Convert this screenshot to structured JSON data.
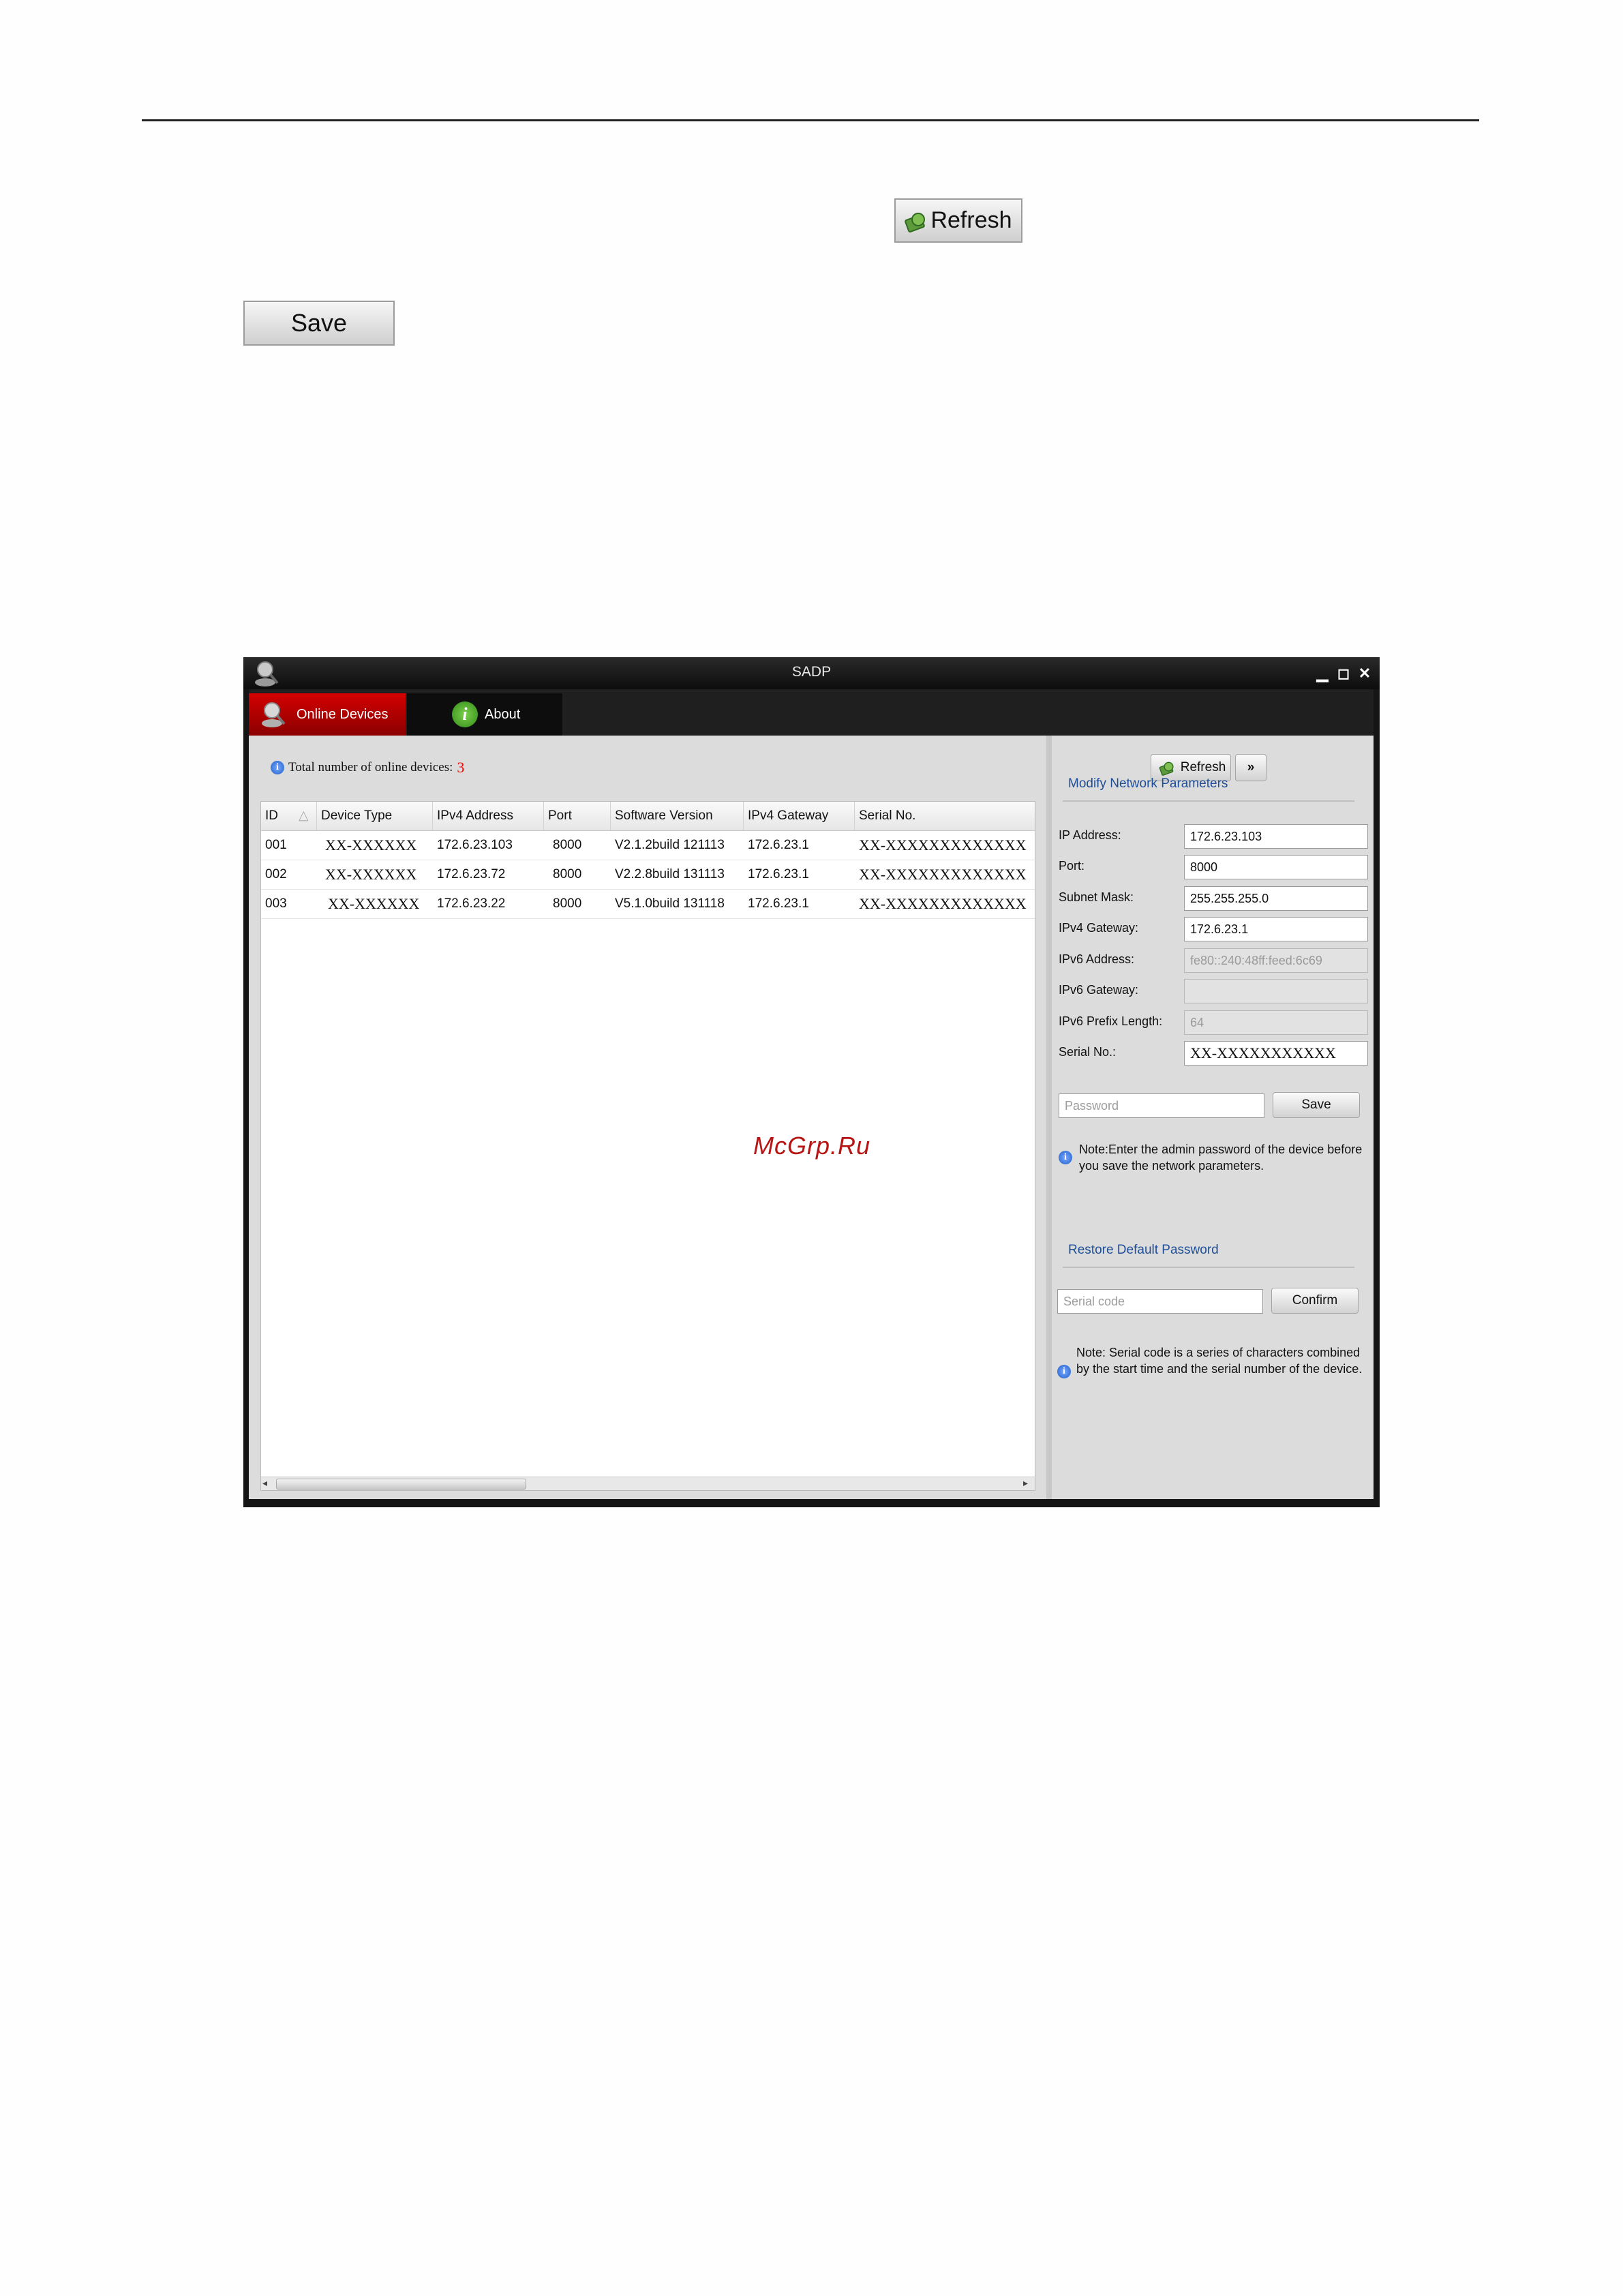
{
  "document": {
    "refresh_label": "Refresh",
    "save_label": "Save",
    "watermark": "McGrp.Ru"
  },
  "window": {
    "title": "SADP",
    "controls": {
      "minimize": "▁",
      "maximize": "◻",
      "close": "✕"
    },
    "tabs": [
      {
        "label": "Online Devices",
        "active": true
      },
      {
        "label": "About",
        "active": false
      }
    ]
  },
  "devices_panel": {
    "total_label": "Total number of online devices:",
    "total_count": "3",
    "refresh_label": "Refresh",
    "more_label": "»",
    "columns": [
      "ID",
      "Device Type",
      "IPv4 Address",
      "Port",
      "Software Version",
      "IPv4 Gateway",
      "Serial No."
    ],
    "rows": [
      [
        "001",
        "XX-XXXXXX",
        "172.6.23.103",
        "8000",
        "V2.1.2build 121113",
        "172.6.23.1",
        "XX-XXXXXXXXXXXXX"
      ],
      [
        "002",
        "XX-XXXXXX",
        "172.6.23.72",
        "8000",
        "V2.2.8build 131113",
        "172.6.23.1",
        "XX-XXXXXXXXXXXXX"
      ],
      [
        "003",
        "XX-XXXXXX",
        "172.6.23.22",
        "8000",
        "V5.1.0build 131118",
        "172.6.23.1",
        "XX-XXXXXXXXXXXXX"
      ]
    ]
  },
  "modify_panel": {
    "title": "Modify Network Parameters",
    "fields": [
      {
        "label": "IP Address:",
        "value": "172.6.23.103",
        "disabled": false
      },
      {
        "label": "Port:",
        "value": "8000",
        "disabled": false
      },
      {
        "label": "Subnet Mask:",
        "value": "255.255.255.0",
        "disabled": false
      },
      {
        "label": "IPv4 Gateway:",
        "value": "172.6.23.1",
        "disabled": false
      },
      {
        "label": "IPv6 Address:",
        "value": "fe80::240:48ff:feed:6c69",
        "disabled": true
      },
      {
        "label": "IPv6 Gateway:",
        "value": "",
        "disabled": true
      },
      {
        "label": "IPv6 Prefix Length:",
        "value": "64",
        "disabled": true
      },
      {
        "label": "Serial No.:",
        "value": "XX-XXXXXXXXXXX",
        "disabled": false
      }
    ],
    "password_placeholder": "Password",
    "save_label": "Save",
    "note": "Note:Enter the admin password of the device before you save the network parameters."
  },
  "restore_panel": {
    "title": "Restore Default Password",
    "serial_placeholder": "Serial code",
    "confirm_label": "Confirm",
    "note": "Note: Serial code is a series of characters combined by the start time and the serial number of the device."
  },
  "colors": {
    "accent_red": "#c40000",
    "link_blue": "#1e4e97",
    "count_red": "#e00000"
  },
  "icons": [
    "refresh-icon",
    "sadp-logo-icon",
    "online-devices-icon",
    "about-icon",
    "info-icon"
  ]
}
